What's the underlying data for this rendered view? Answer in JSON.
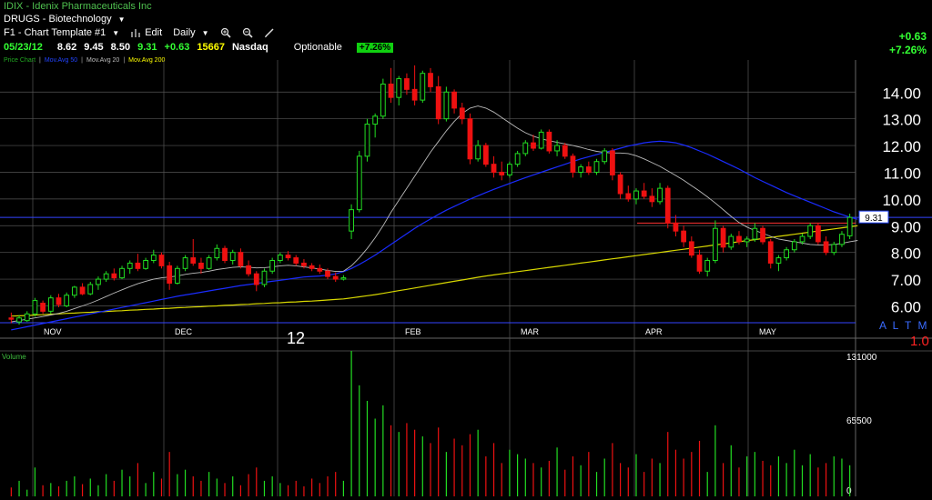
{
  "header": {
    "title": "IDIX - Idenix Pharmaceuticals Inc",
    "group": "DRUGS - Biotechnology",
    "template": "F1 - Chart Template #1",
    "edit_label": "Edit",
    "period": "Daily",
    "quote": {
      "date": "05/23/12",
      "open": "8.62",
      "high": "9.45",
      "low": "8.50",
      "last": "9.31",
      "change": "+0.63",
      "volume": "15667",
      "exchange": "Nasdaq",
      "optionable": "Optionable",
      "pct": "+7.26%"
    },
    "legend": {
      "price": "Price Chart",
      "ma50": "Mov.Avg 50",
      "ma20": "Mov.Avg 20",
      "ma200": "Mov.Avg 200"
    },
    "corner_change": "+0.63",
    "corner_pct": "+7.26%"
  },
  "colors": {
    "up": "#22dd22",
    "down": "#ee1111",
    "ma20": "#bbbbbb",
    "ma50": "#1a2cff",
    "ma200": "#d8d800",
    "grid": "#555555",
    "price_line": "#3344ff",
    "res_line": "#ff3333"
  },
  "chart_data": {
    "type": "candlestick",
    "symbol": "IDIX",
    "y_ticks": [
      "14.00",
      "13.00",
      "12.00",
      "11.00",
      "10.00",
      "9.00",
      "8.00",
      "7.00",
      "6.00"
    ],
    "ylim": [
      5.2,
      15.2
    ],
    "x_labels": [
      "NOV",
      "DEC",
      "12",
      "FEB",
      "MAR",
      "APR",
      "MAY"
    ],
    "last_price_label": "9.31",
    "last_price": 9.31,
    "scale_labels": [
      "A",
      "L",
      "T",
      "M",
      "L"
    ],
    "scale_factor": "1.0",
    "volume_ticks": [
      "131000",
      "65500",
      "0"
    ],
    "volume_max": 131000,
    "volume_label": "Volume",
    "candles": [
      {
        "o": 5.55,
        "h": 5.75,
        "l": 5.35,
        "c": 5.5
      },
      {
        "o": 5.4,
        "h": 5.65,
        "l": 5.3,
        "c": 5.55
      },
      {
        "o": 5.45,
        "h": 5.8,
        "l": 5.4,
        "c": 5.7
      },
      {
        "o": 5.7,
        "h": 6.3,
        "l": 5.6,
        "c": 6.2
      },
      {
        "o": 6.1,
        "h": 6.2,
        "l": 5.7,
        "c": 5.8
      },
      {
        "o": 5.8,
        "h": 6.4,
        "l": 5.7,
        "c": 6.3
      },
      {
        "o": 6.3,
        "h": 6.45,
        "l": 5.95,
        "c": 6.05
      },
      {
        "o": 6.0,
        "h": 6.5,
        "l": 5.95,
        "c": 6.4
      },
      {
        "o": 6.4,
        "h": 6.75,
        "l": 6.3,
        "c": 6.7
      },
      {
        "o": 6.7,
        "h": 6.85,
        "l": 6.4,
        "c": 6.45
      },
      {
        "o": 6.45,
        "h": 6.9,
        "l": 6.4,
        "c": 6.8
      },
      {
        "o": 6.8,
        "h": 7.1,
        "l": 6.6,
        "c": 7.0
      },
      {
        "o": 7.0,
        "h": 7.3,
        "l": 6.9,
        "c": 7.2
      },
      {
        "o": 7.2,
        "h": 7.4,
        "l": 6.95,
        "c": 7.05
      },
      {
        "o": 7.05,
        "h": 7.5,
        "l": 7.0,
        "c": 7.4
      },
      {
        "o": 7.4,
        "h": 7.7,
        "l": 7.2,
        "c": 7.6
      },
      {
        "o": 7.6,
        "h": 7.95,
        "l": 7.3,
        "c": 7.4
      },
      {
        "o": 7.4,
        "h": 7.8,
        "l": 7.35,
        "c": 7.7
      },
      {
        "o": 7.7,
        "h": 8.1,
        "l": 7.6,
        "c": 7.9
      },
      {
        "o": 7.9,
        "h": 8.0,
        "l": 7.4,
        "c": 7.5
      },
      {
        "o": 7.5,
        "h": 7.65,
        "l": 6.6,
        "c": 6.85
      },
      {
        "o": 6.85,
        "h": 7.5,
        "l": 6.8,
        "c": 7.4
      },
      {
        "o": 7.4,
        "h": 7.9,
        "l": 7.3,
        "c": 7.8
      },
      {
        "o": 7.8,
        "h": 8.5,
        "l": 7.5,
        "c": 7.6
      },
      {
        "o": 7.6,
        "h": 7.8,
        "l": 7.2,
        "c": 7.4
      },
      {
        "o": 7.4,
        "h": 7.9,
        "l": 7.35,
        "c": 7.8
      },
      {
        "o": 7.8,
        "h": 8.3,
        "l": 7.7,
        "c": 8.15
      },
      {
        "o": 8.15,
        "h": 8.25,
        "l": 7.6,
        "c": 7.7
      },
      {
        "o": 7.7,
        "h": 8.1,
        "l": 7.55,
        "c": 8.0
      },
      {
        "o": 8.0,
        "h": 8.15,
        "l": 7.4,
        "c": 7.5
      },
      {
        "o": 7.5,
        "h": 7.7,
        "l": 7.1,
        "c": 7.2
      },
      {
        "o": 7.2,
        "h": 7.3,
        "l": 6.55,
        "c": 6.8
      },
      {
        "o": 6.8,
        "h": 7.4,
        "l": 6.7,
        "c": 7.3
      },
      {
        "o": 7.3,
        "h": 7.8,
        "l": 7.2,
        "c": 7.7
      },
      {
        "o": 7.7,
        "h": 8.0,
        "l": 7.6,
        "c": 7.9
      },
      {
        "o": 7.9,
        "h": 8.05,
        "l": 7.7,
        "c": 7.8
      },
      {
        "o": 7.8,
        "h": 7.9,
        "l": 7.5,
        "c": 7.6
      },
      {
        "o": 7.6,
        "h": 7.75,
        "l": 7.4,
        "c": 7.5
      },
      {
        "o": 7.5,
        "h": 7.6,
        "l": 7.3,
        "c": 7.4
      },
      {
        "o": 7.4,
        "h": 7.55,
        "l": 7.2,
        "c": 7.3
      },
      {
        "o": 7.3,
        "h": 7.4,
        "l": 7.0,
        "c": 7.1
      },
      {
        "o": 7.1,
        "h": 7.25,
        "l": 6.9,
        "c": 7.0
      },
      {
        "o": 7.0,
        "h": 7.15,
        "l": 6.95,
        "c": 7.05
      },
      {
        "o": 8.8,
        "h": 9.8,
        "l": 8.5,
        "c": 9.6
      },
      {
        "o": 9.6,
        "h": 11.8,
        "l": 9.5,
        "c": 11.6
      },
      {
        "o": 11.6,
        "h": 13.0,
        "l": 11.4,
        "c": 12.8
      },
      {
        "o": 12.8,
        "h": 13.2,
        "l": 12.3,
        "c": 13.1
      },
      {
        "o": 13.1,
        "h": 14.5,
        "l": 13.0,
        "c": 14.3
      },
      {
        "o": 14.3,
        "h": 14.9,
        "l": 13.6,
        "c": 13.8
      },
      {
        "o": 13.8,
        "h": 14.6,
        "l": 13.5,
        "c": 14.5
      },
      {
        "o": 14.5,
        "h": 14.7,
        "l": 13.9,
        "c": 14.1
      },
      {
        "o": 14.1,
        "h": 15.0,
        "l": 13.5,
        "c": 13.7
      },
      {
        "o": 13.7,
        "h": 14.8,
        "l": 13.6,
        "c": 14.7
      },
      {
        "o": 14.7,
        "h": 14.9,
        "l": 14.0,
        "c": 14.2
      },
      {
        "o": 14.2,
        "h": 14.6,
        "l": 12.8,
        "c": 13.0
      },
      {
        "o": 13.0,
        "h": 14.2,
        "l": 12.9,
        "c": 14.0
      },
      {
        "o": 14.0,
        "h": 14.1,
        "l": 13.2,
        "c": 13.4
      },
      {
        "o": 13.4,
        "h": 13.6,
        "l": 12.8,
        "c": 13.0
      },
      {
        "o": 13.0,
        "h": 13.2,
        "l": 11.3,
        "c": 11.5
      },
      {
        "o": 11.5,
        "h": 12.2,
        "l": 11.4,
        "c": 12.0
      },
      {
        "o": 12.0,
        "h": 12.1,
        "l": 11.2,
        "c": 11.3
      },
      {
        "o": 11.3,
        "h": 11.6,
        "l": 10.8,
        "c": 11.0
      },
      {
        "o": 11.0,
        "h": 11.4,
        "l": 10.7,
        "c": 10.9
      },
      {
        "o": 10.9,
        "h": 11.4,
        "l": 10.8,
        "c": 11.3
      },
      {
        "o": 11.3,
        "h": 11.8,
        "l": 11.2,
        "c": 11.7
      },
      {
        "o": 11.7,
        "h": 12.2,
        "l": 11.6,
        "c": 12.1
      },
      {
        "o": 12.1,
        "h": 12.4,
        "l": 11.8,
        "c": 11.9
      },
      {
        "o": 11.9,
        "h": 12.6,
        "l": 11.85,
        "c": 12.5
      },
      {
        "o": 12.5,
        "h": 12.6,
        "l": 11.7,
        "c": 11.8
      },
      {
        "o": 11.8,
        "h": 12.2,
        "l": 11.6,
        "c": 12.0
      },
      {
        "o": 12.0,
        "h": 12.1,
        "l": 11.5,
        "c": 11.6
      },
      {
        "o": 11.6,
        "h": 11.7,
        "l": 10.8,
        "c": 11.0
      },
      {
        "o": 11.0,
        "h": 11.3,
        "l": 10.8,
        "c": 11.2
      },
      {
        "o": 11.2,
        "h": 11.4,
        "l": 10.9,
        "c": 11.0
      },
      {
        "o": 11.0,
        "h": 11.5,
        "l": 10.9,
        "c": 11.4
      },
      {
        "o": 11.4,
        "h": 11.9,
        "l": 11.3,
        "c": 11.8
      },
      {
        "o": 11.8,
        "h": 11.9,
        "l": 10.7,
        "c": 10.9
      },
      {
        "o": 10.9,
        "h": 11.0,
        "l": 10.0,
        "c": 10.2
      },
      {
        "o": 10.2,
        "h": 10.5,
        "l": 9.9,
        "c": 10.0
      },
      {
        "o": 10.0,
        "h": 10.4,
        "l": 9.8,
        "c": 10.3
      },
      {
        "o": 10.3,
        "h": 10.6,
        "l": 10.0,
        "c": 10.1
      },
      {
        "o": 10.1,
        "h": 10.4,
        "l": 9.7,
        "c": 9.9
      },
      {
        "o": 9.9,
        "h": 10.6,
        "l": 9.8,
        "c": 10.4
      },
      {
        "o": 10.4,
        "h": 10.5,
        "l": 8.9,
        "c": 9.1
      },
      {
        "o": 9.1,
        "h": 9.4,
        "l": 8.6,
        "c": 8.8
      },
      {
        "o": 8.8,
        "h": 9.0,
        "l": 8.2,
        "c": 8.4
      },
      {
        "o": 8.4,
        "h": 8.6,
        "l": 7.8,
        "c": 7.9
      },
      {
        "o": 7.9,
        "h": 8.1,
        "l": 7.2,
        "c": 7.3
      },
      {
        "o": 7.3,
        "h": 7.8,
        "l": 7.1,
        "c": 7.7
      },
      {
        "o": 7.7,
        "h": 9.2,
        "l": 7.6,
        "c": 8.9
      },
      {
        "o": 8.9,
        "h": 9.0,
        "l": 8.0,
        "c": 8.2
      },
      {
        "o": 8.2,
        "h": 8.7,
        "l": 8.1,
        "c": 8.6
      },
      {
        "o": 8.6,
        "h": 8.8,
        "l": 8.3,
        "c": 8.4
      },
      {
        "o": 8.4,
        "h": 8.6,
        "l": 8.2,
        "c": 8.5
      },
      {
        "o": 8.5,
        "h": 9.1,
        "l": 8.4,
        "c": 8.9
      },
      {
        "o": 8.9,
        "h": 9.0,
        "l": 8.3,
        "c": 8.4
      },
      {
        "o": 8.4,
        "h": 8.5,
        "l": 7.4,
        "c": 7.6
      },
      {
        "o": 7.6,
        "h": 7.9,
        "l": 7.3,
        "c": 7.8
      },
      {
        "o": 7.8,
        "h": 8.2,
        "l": 7.7,
        "c": 8.1
      },
      {
        "o": 8.1,
        "h": 8.5,
        "l": 8.0,
        "c": 8.4
      },
      {
        "o": 8.4,
        "h": 8.7,
        "l": 8.3,
        "c": 8.6
      },
      {
        "o": 8.6,
        "h": 9.1,
        "l": 8.5,
        "c": 9.0
      },
      {
        "o": 9.0,
        "h": 9.1,
        "l": 8.3,
        "c": 8.4
      },
      {
        "o": 8.4,
        "h": 8.6,
        "l": 7.9,
        "c": 8.0
      },
      {
        "o": 8.0,
        "h": 8.4,
        "l": 7.9,
        "c": 8.3
      },
      {
        "o": 8.3,
        "h": 8.8,
        "l": 8.2,
        "c": 8.68
      },
      {
        "o": 8.62,
        "h": 9.45,
        "l": 8.5,
        "c": 9.31
      }
    ],
    "volume": [
      8,
      14,
      6,
      26,
      10,
      12,
      9,
      14,
      18,
      11,
      16,
      10,
      20,
      14,
      24,
      18,
      30,
      12,
      22,
      16,
      40,
      20,
      24,
      18,
      14,
      22,
      16,
      12,
      18,
      10,
      20,
      26,
      14,
      18,
      12,
      10,
      14,
      9,
      16,
      12,
      18,
      22,
      14,
      131000,
      100,
      86,
      70,
      82,
      64,
      58,
      66,
      60,
      54,
      48,
      62,
      40,
      52,
      46,
      56,
      60,
      36,
      48,
      30,
      42,
      38,
      34,
      30,
      26,
      32,
      44,
      24,
      36,
      28,
      40,
      22,
      34,
      48,
      30,
      26,
      38,
      22,
      34,
      30,
      58,
      42,
      34,
      40,
      50,
      22,
      64,
      30,
      46,
      26,
      36,
      40,
      32,
      28,
      36,
      30,
      42,
      28,
      38,
      26,
      30,
      36,
      34,
      28
    ],
    "ma20": [
      5.4,
      5.45,
      5.5,
      5.55,
      5.6,
      5.66,
      5.72,
      5.8,
      5.9,
      6.0,
      6.1,
      6.22,
      6.35,
      6.48,
      6.6,
      6.72,
      6.83,
      6.92,
      7.0,
      7.05,
      7.08,
      7.12,
      7.18,
      7.22,
      7.25,
      7.3,
      7.36,
      7.4,
      7.44,
      7.46,
      7.45,
      7.42,
      7.43,
      7.46,
      7.5,
      7.52,
      7.5,
      7.46,
      7.42,
      7.38,
      7.33,
      7.29,
      7.3,
      7.5,
      7.8,
      8.15,
      8.55,
      9.0,
      9.5,
      9.95,
      10.4,
      10.85,
      11.3,
      11.75,
      12.15,
      12.55,
      12.9,
      13.2,
      13.4,
      13.48,
      13.4,
      13.25,
      13.05,
      12.85,
      12.65,
      12.48,
      12.35,
      12.25,
      12.18,
      12.12,
      12.06,
      12.0,
      11.93,
      11.85,
      11.78,
      11.74,
      11.72,
      11.72,
      11.7,
      11.62,
      11.5,
      11.36,
      11.22,
      11.05,
      10.88,
      10.7,
      10.5,
      10.3,
      10.08,
      9.85,
      9.6,
      9.35,
      9.12,
      8.95,
      8.82,
      8.72,
      8.6,
      8.5,
      8.45,
      8.4,
      8.35,
      8.3,
      8.28,
      8.28,
      8.3,
      8.34,
      8.4,
      8.45
    ],
    "ma50": [
      5.1,
      5.16,
      5.22,
      5.28,
      5.34,
      5.4,
      5.46,
      5.52,
      5.58,
      5.64,
      5.7,
      5.76,
      5.82,
      5.88,
      5.94,
      6.0,
      6.06,
      6.12,
      6.18,
      6.24,
      6.3,
      6.36,
      6.41,
      6.46,
      6.51,
      6.56,
      6.61,
      6.66,
      6.71,
      6.76,
      6.8,
      6.84,
      6.88,
      6.92,
      6.96,
      7.0,
      7.04,
      7.08,
      7.1,
      7.12,
      7.15,
      7.2,
      7.28,
      7.4,
      7.55,
      7.72,
      7.9,
      8.1,
      8.3,
      8.5,
      8.7,
      8.9,
      9.08,
      9.25,
      9.42,
      9.58,
      9.72,
      9.86,
      10.0,
      10.12,
      10.24,
      10.36,
      10.47,
      10.58,
      10.69,
      10.8,
      10.9,
      11.0,
      11.1,
      11.2,
      11.3,
      11.4,
      11.5,
      11.58,
      11.66,
      11.74,
      11.82,
      11.9,
      11.98,
      12.04,
      12.1,
      12.14,
      12.16,
      12.14,
      12.1,
      12.02,
      11.92,
      11.8,
      11.68,
      11.54,
      11.4,
      11.26,
      11.12,
      10.96,
      10.8,
      10.66,
      10.52,
      10.38,
      10.24,
      10.12,
      10.0,
      9.88,
      9.76,
      9.64,
      9.52,
      9.42,
      9.32,
      9.24
    ],
    "ma200": [
      5.62,
      5.63,
      5.64,
      5.66,
      5.67,
      5.69,
      5.7,
      5.72,
      5.73,
      5.75,
      5.76,
      5.78,
      5.79,
      5.81,
      5.82,
      5.84,
      5.85,
      5.87,
      5.88,
      5.9,
      5.91,
      5.93,
      5.94,
      5.96,
      5.97,
      5.99,
      6.0,
      6.02,
      6.03,
      6.05,
      6.06,
      6.08,
      6.09,
      6.11,
      6.12,
      6.14,
      6.15,
      6.17,
      6.18,
      6.2,
      6.22,
      6.24,
      6.26,
      6.3,
      6.34,
      6.38,
      6.42,
      6.47,
      6.52,
      6.57,
      6.62,
      6.67,
      6.72,
      6.77,
      6.82,
      6.87,
      6.92,
      6.97,
      7.02,
      7.07,
      7.12,
      7.16,
      7.2,
      7.24,
      7.28,
      7.32,
      7.36,
      7.4,
      7.44,
      7.48,
      7.52,
      7.56,
      7.6,
      7.64,
      7.68,
      7.72,
      7.76,
      7.8,
      7.84,
      7.88,
      7.92,
      7.96,
      8.0,
      8.04,
      8.08,
      8.12,
      8.16,
      8.2,
      8.24,
      8.28,
      8.32,
      8.36,
      8.4,
      8.44,
      8.48,
      8.52,
      8.56,
      8.6,
      8.64,
      8.68,
      8.72,
      8.76,
      8.8,
      8.84,
      8.88,
      8.92,
      8.96,
      9.0
    ]
  }
}
